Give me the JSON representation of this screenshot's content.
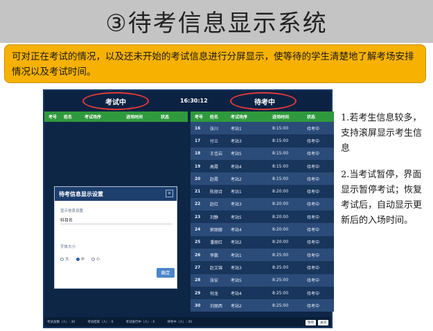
{
  "slide": {
    "title": "③待考信息显示系统",
    "intro": "可对正在考试的情况，以及还未开始的考试信息进行分屏显示，使等待的学生清楚地了解考场安排情况以及考试时间。"
  },
  "screen": {
    "left_title": "考试中",
    "clock": "16:30:12",
    "right_title": "待考中",
    "columns": [
      "考号",
      "姓名",
      "考试场序",
      "进场时间",
      "状态"
    ],
    "rows": [
      {
        "no": "16",
        "name": "张川",
        "room": "考站1",
        "time": "8:15:00",
        "state": "待考中"
      },
      {
        "no": "17",
        "name": "付兰",
        "room": "考站3",
        "time": "8:15:00",
        "state": "待考中"
      },
      {
        "no": "18",
        "name": "王佳岩",
        "room": "考站5",
        "time": "8:15:00",
        "state": "待考中"
      },
      {
        "no": "19",
        "name": "高霞",
        "room": "考站4",
        "time": "8:15:00",
        "state": "待考中"
      },
      {
        "no": "20",
        "name": "赵霞",
        "room": "考站2",
        "time": "8:15:00",
        "state": "待考中"
      },
      {
        "no": "21",
        "name": "陈丽诗",
        "room": "考站1",
        "time": "8:20:00",
        "state": "待考中"
      },
      {
        "no": "22",
        "name": "赵红",
        "room": "考站3",
        "time": "8:20:00",
        "state": "待考中"
      },
      {
        "no": "23",
        "name": "刘静",
        "room": "考站5",
        "time": "8:20:00",
        "state": "待考中"
      },
      {
        "no": "24",
        "name": "郭丽娜",
        "room": "考站4",
        "time": "8:20:00",
        "state": "待考中"
      },
      {
        "no": "25",
        "name": "潘丽红",
        "room": "考站2",
        "time": "8:20:00",
        "state": "待考中"
      },
      {
        "no": "26",
        "name": "李鹏",
        "room": "考站1",
        "time": "8:25:00",
        "state": "待考中"
      },
      {
        "no": "27",
        "name": "赵文锦",
        "room": "考站3",
        "time": "8:25:00",
        "state": "待考中"
      },
      {
        "no": "28",
        "name": "张安",
        "room": "考站5",
        "time": "8:25:00",
        "state": "待考中"
      },
      {
        "no": "29",
        "name": "何龙",
        "room": "考站4",
        "time": "8:25:00",
        "state": "待考中"
      },
      {
        "no": "30",
        "name": "刘丽西",
        "room": "考站2",
        "time": "8:25:00",
        "state": "待考中"
      }
    ],
    "dialog": {
      "title": "待考信息显示设置",
      "close": "×",
      "label1": "显示信息设置",
      "value1": "科目名",
      "label2": "字体大小",
      "radios": [
        "大",
        "中",
        "小"
      ],
      "ok": "确定"
    },
    "footer": {
      "items": [
        "考试总数（人）: 30",
        "考试结束（人）: 0",
        "考试进行中（人）: 0",
        "待考中（人）: 30"
      ],
      "btn1": "暂停",
      "btn2": "关闭"
    }
  },
  "notes": [
    "1.若考生信息较多，支持滚屏显示考生信息",
    "2.当考试暂停，界面显示暂停考试；恢复考试后，自动显示更新后的入场时间。"
  ]
}
